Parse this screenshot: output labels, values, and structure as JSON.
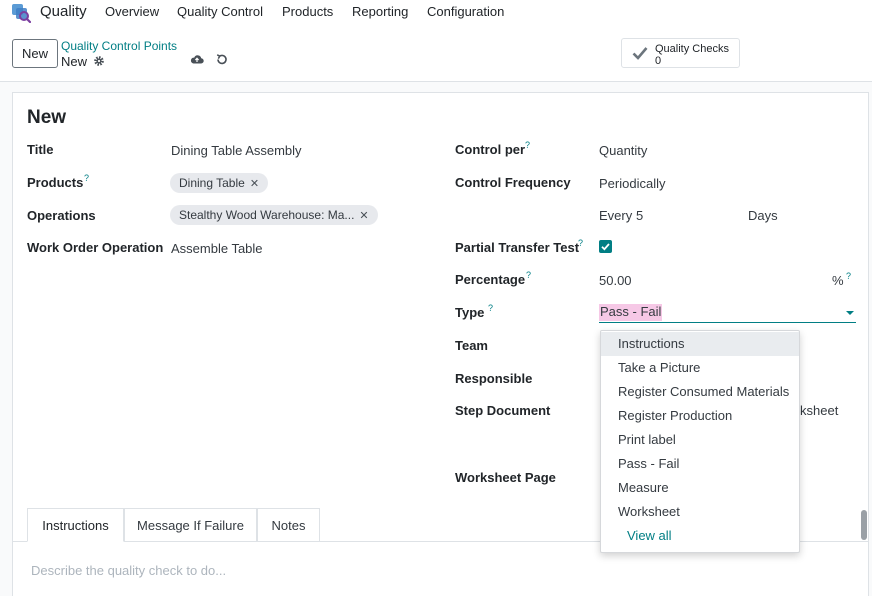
{
  "nav": {
    "app_name": "Quality",
    "menu": [
      "Overview",
      "Quality Control",
      "Products",
      "Reporting",
      "Configuration"
    ]
  },
  "control_panel": {
    "new_button": "New",
    "breadcrumb_parent": "Quality Control Points",
    "breadcrumb_current": "New",
    "stat_button": {
      "label": "Quality Checks",
      "value": "0"
    }
  },
  "form": {
    "record_title": "New",
    "left": {
      "title_label": "Title",
      "title_value": "Dining Table Assembly",
      "products_label": "Products",
      "products_help": "?",
      "products_tags": [
        "Dining Table"
      ],
      "operations_label": "Operations",
      "operations_tags": [
        "Stealthy Wood Warehouse: Ma..."
      ],
      "wo_operation_label": "Work Order Operation",
      "wo_operation_value": "Assemble Table"
    },
    "right": {
      "control_per_label": "Control per",
      "control_per_help": "?",
      "control_per_value": "Quantity",
      "frequency_label": "Control Frequency",
      "frequency_value": "Periodically",
      "every_label": "Every",
      "every_value": "5",
      "every_unit": "Days",
      "partial_label": "Partial Transfer Test",
      "partial_help": "?",
      "partial_checked": true,
      "percentage_label": "Percentage",
      "percentage_help": "?",
      "percentage_value": "50.00",
      "percentage_unit": "%",
      "percentage_unit_help": "?",
      "type_label": "Type",
      "type_help": "?",
      "type_value": "Pass - Fail",
      "team_label": "Team",
      "responsible_label": "Responsible",
      "step_document_label": "Step Document",
      "step_document_value_partial": "ksheet",
      "worksheet_page_label": "Worksheet Page"
    },
    "type_dropdown": {
      "options": [
        "Instructions",
        "Take a Picture",
        "Register Consumed Materials",
        "Register Production",
        "Print label",
        "Pass - Fail",
        "Measure",
        "Worksheet"
      ],
      "highlighted": "Instructions",
      "view_all": "View all"
    },
    "tabs": [
      "Instructions",
      "Message If Failure",
      "Notes"
    ],
    "active_tab": "Instructions",
    "notes_placeholder": "Describe the quality check to do..."
  },
  "colors": {
    "accent": "#017e84",
    "highlight": "#f6c8e6",
    "tag_bg": "#e7e9ed"
  }
}
